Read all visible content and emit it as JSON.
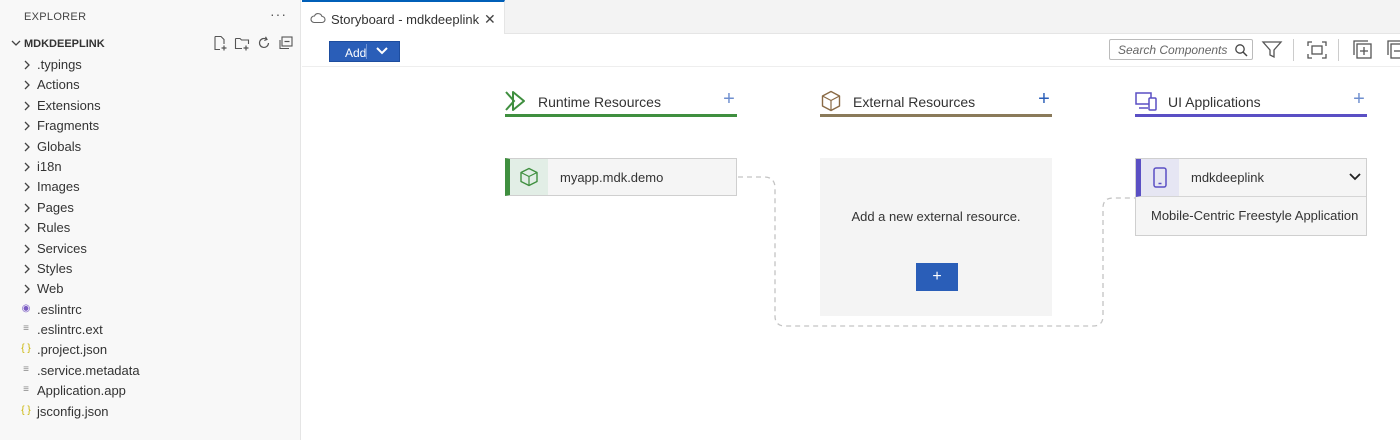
{
  "sidebar": {
    "header": "EXPLORER",
    "more": "···",
    "root": "MDKDEEPLINK",
    "folders": [
      {
        "label": ".typings"
      },
      {
        "label": "Actions"
      },
      {
        "label": "Extensions"
      },
      {
        "label": "Fragments"
      },
      {
        "label": "Globals"
      },
      {
        "label": "i18n"
      },
      {
        "label": "Images"
      },
      {
        "label": "Pages"
      },
      {
        "label": "Rules"
      },
      {
        "label": "Services"
      },
      {
        "label": "Styles"
      },
      {
        "label": "Web"
      }
    ],
    "files": [
      {
        "label": ".eslintrc",
        "icon": "eslint-icon",
        "glyph": "◉"
      },
      {
        "label": ".eslintrc.ext",
        "icon": "text-file-icon",
        "glyph": "≡"
      },
      {
        "label": ".project.json",
        "icon": "json-file-icon",
        "glyph": "{ }"
      },
      {
        "label": ".service.metadata",
        "icon": "text-file-icon",
        "glyph": "≡"
      },
      {
        "label": "Application.app",
        "icon": "text-file-icon",
        "glyph": "≡"
      },
      {
        "label": "jsconfig.json",
        "icon": "json-file-icon",
        "glyph": "{ }"
      }
    ]
  },
  "tab": {
    "label": "Storyboard - mdkdeeplink",
    "close": "✕"
  },
  "toolbar": {
    "add_label": "Add",
    "search_placeholder": "Search Components"
  },
  "columns": {
    "runtime": {
      "label": "Runtime Resources",
      "plus": "+",
      "color": "#3f8f3f"
    },
    "external": {
      "label": "External Resources",
      "plus": "+",
      "color": "#8a7a5a"
    },
    "ui": {
      "label": "UI Applications",
      "plus": "+",
      "color": "#5a4fc4"
    }
  },
  "nodes": {
    "runtime": {
      "label": "myapp.mdk.demo"
    },
    "external": {
      "text": "Add a new external resource.",
      "button": "+"
    },
    "ui": {
      "label": "mdkdeeplink",
      "subtitle": "Mobile-Centric Freestyle Application"
    }
  },
  "colors": {
    "accent": "#2a5eb8",
    "tab_border": "#005fb8"
  }
}
